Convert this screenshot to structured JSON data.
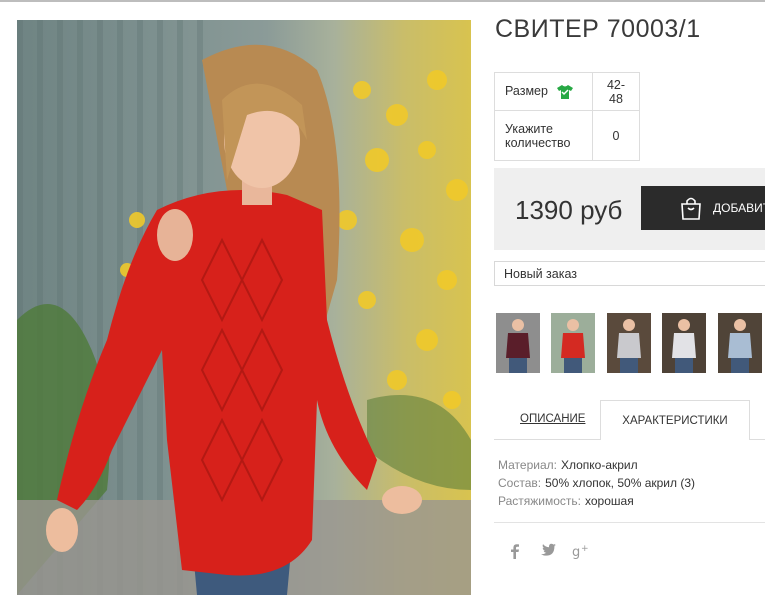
{
  "product": {
    "title": "СВИТЕР 70003/1",
    "options": [
      {
        "label": "Размер",
        "value": "42-48",
        "icon": "tshirt-icon"
      },
      {
        "label": "Укажите количество",
        "value": "0"
      }
    ],
    "price": "1390 руб",
    "buy_label": "ДОБАВИТЬ",
    "order_select_value": "Новый заказ"
  },
  "thumbnails": [
    {
      "name": "thumb-1",
      "color": "#5a1e2a"
    },
    {
      "name": "thumb-2",
      "color": "#d42a22"
    },
    {
      "name": "thumb-3",
      "color": "#c9c9cd"
    },
    {
      "name": "thumb-4",
      "color": "#e2e2e6"
    },
    {
      "name": "thumb-5",
      "color": "#a9bdd3"
    }
  ],
  "tabs": {
    "description": "ОПИСАНИЕ",
    "characteristics": "ХАРАКТЕРИСТИКИ",
    "active": "characteristics"
  },
  "specs": [
    {
      "key": "Материал:",
      "value": "Хлопко-акрил"
    },
    {
      "key": "Состав:",
      "value": "50% хлопок, 50% акрил (3)"
    },
    {
      "key": "Растяжимость:",
      "value": "хорошая"
    }
  ],
  "social": [
    {
      "icon": "facebook-icon",
      "glyph": "f"
    },
    {
      "icon": "twitter-icon",
      "glyph": "🐦"
    },
    {
      "icon": "google-plus-icon",
      "glyph": "g+"
    }
  ],
  "colors": {
    "sweater": "#d7211b",
    "button_bg": "#2b2b2b",
    "price_bg": "#efefef",
    "icon_green": "#27a844"
  }
}
